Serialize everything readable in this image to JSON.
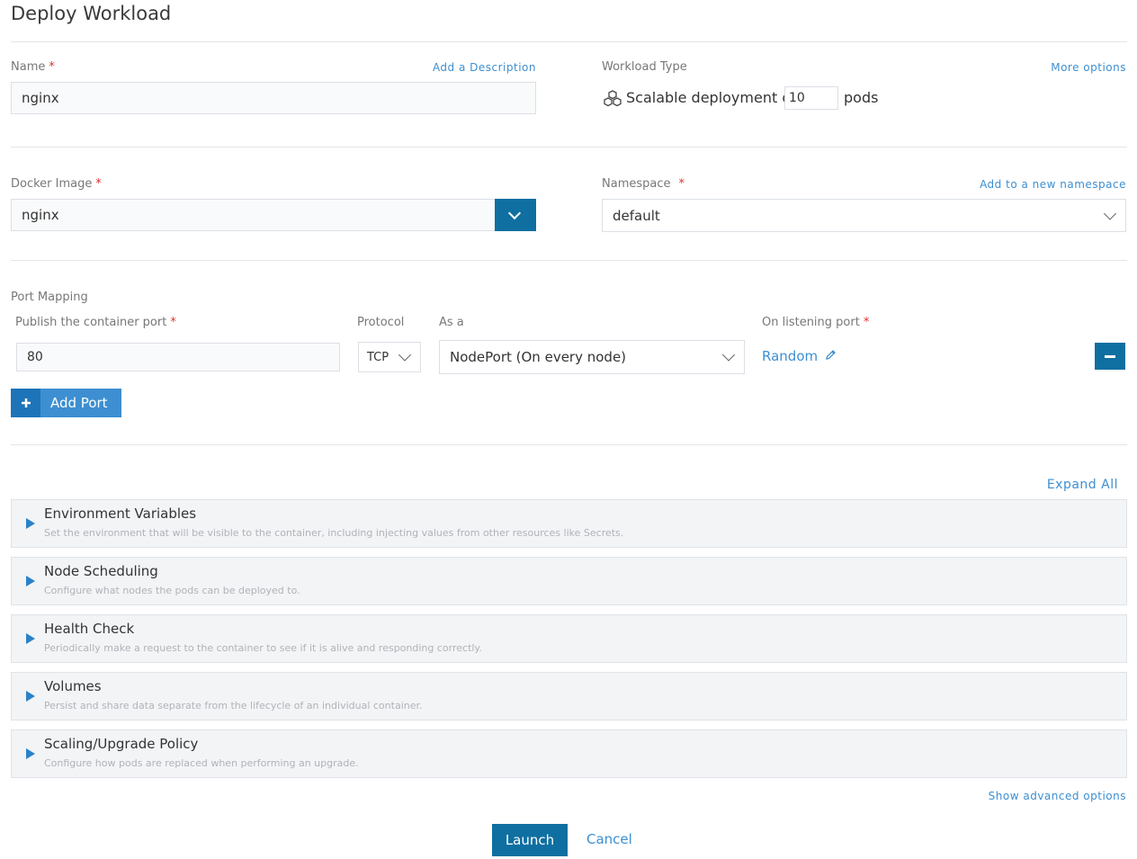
{
  "page": {
    "title": "Deploy Workload"
  },
  "name_section": {
    "label": "Name",
    "required": "*",
    "add_description": "Add a Description",
    "value": "nginx"
  },
  "workload_type": {
    "label": "Workload Type",
    "more_options": "More options",
    "prefix": "Scalable deployment of",
    "pods_value": "10",
    "suffix": "pods"
  },
  "docker_image": {
    "label": "Docker Image",
    "required": "*",
    "value": "nginx"
  },
  "namespace": {
    "label": "Namespace",
    "required": "*",
    "add_new": "Add to a new namespace",
    "value": "default"
  },
  "port_mapping": {
    "label": "Port Mapping",
    "publish_label": "Publish the container port",
    "required": "*",
    "protocol_label": "Protocol",
    "as_a_label": "As a",
    "listening_label": "On listening port",
    "port_value": "80",
    "protocol_value": "TCP",
    "as_a_value": "NodePort (On every node)",
    "listening_value": "Random",
    "add_port": "Add Port"
  },
  "expand_all": "Expand All",
  "sections": [
    {
      "title": "Environment Variables",
      "description": "Set the environment that will be visible to the container, including injecting values from other resources like Secrets."
    },
    {
      "title": "Node Scheduling",
      "description": "Configure what nodes the pods can be deployed to."
    },
    {
      "title": "Health Check",
      "description": "Periodically make a request to the container to see if it is alive and responding correctly."
    },
    {
      "title": "Volumes",
      "description": "Persist and share data separate from the lifecycle of an individual container."
    },
    {
      "title": "Scaling/Upgrade Policy",
      "description": "Configure how pods are replaced when performing an upgrade."
    }
  ],
  "show_advanced": "Show advanced options",
  "actions": {
    "launch": "Launch",
    "cancel": "Cancel"
  },
  "colors": {
    "primary": "#0f6fa1",
    "link": "#3d8fd1",
    "required": "#e3302f"
  }
}
